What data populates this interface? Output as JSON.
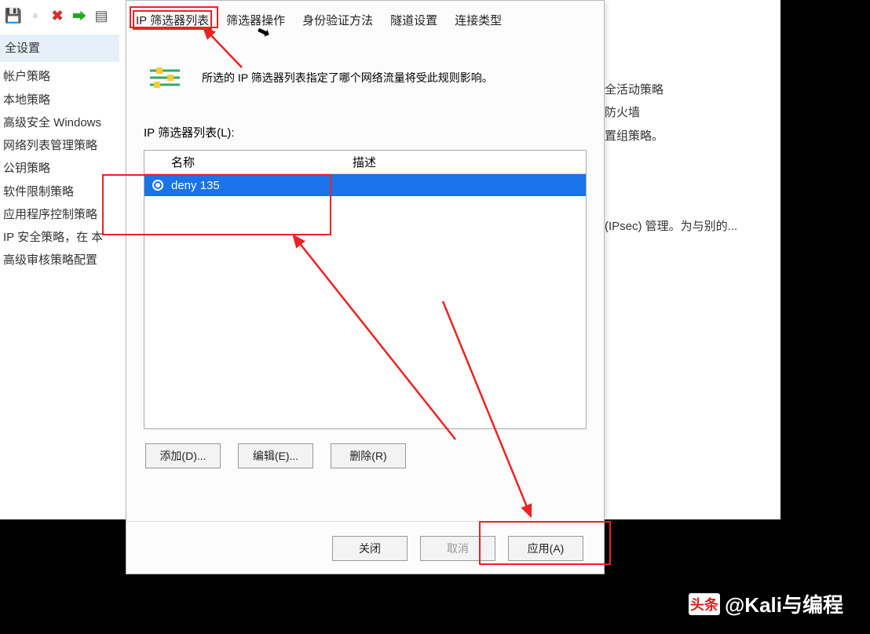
{
  "toolbar_icons": [
    "save-icon",
    "page-icon",
    "close-x-icon",
    "export-icon",
    "doc-icon"
  ],
  "left": {
    "title": "全设置",
    "items": [
      "帐户策略",
      "本地策略",
      "高级安全 Windows",
      "网络列表管理策略",
      "公钥策略",
      "软件限制策略",
      "应用程序控制策略",
      "IP 安全策略，在 本",
      "高级审核策略配置"
    ]
  },
  "right_text": {
    "line1": "全活动策略",
    "line2": "防火墙",
    "line3": "置组策略。",
    "line4": "(IPsec) 管理。为与别的..."
  },
  "dialog": {
    "tabs": [
      "IP 筛选器列表",
      "筛选器操作",
      "身份验证方法",
      "隧道设置",
      "连接类型"
    ],
    "info_text": "所选的 IP 筛选器列表指定了哪个网络流量将受此规则影响。",
    "list_label": "IP 筛选器列表(L):",
    "columns": {
      "name": "名称",
      "desc": "描述"
    },
    "rows": [
      {
        "name": "deny 135",
        "desc": ""
      }
    ],
    "buttons": {
      "add": "添加(D)...",
      "edit": "编辑(E)...",
      "remove": "删除(R)"
    },
    "footer": {
      "close": "关闭",
      "cancel": "取消",
      "apply": "应用(A)"
    }
  },
  "watermark": "@Kali与编程",
  "watermark_tag": "头条"
}
